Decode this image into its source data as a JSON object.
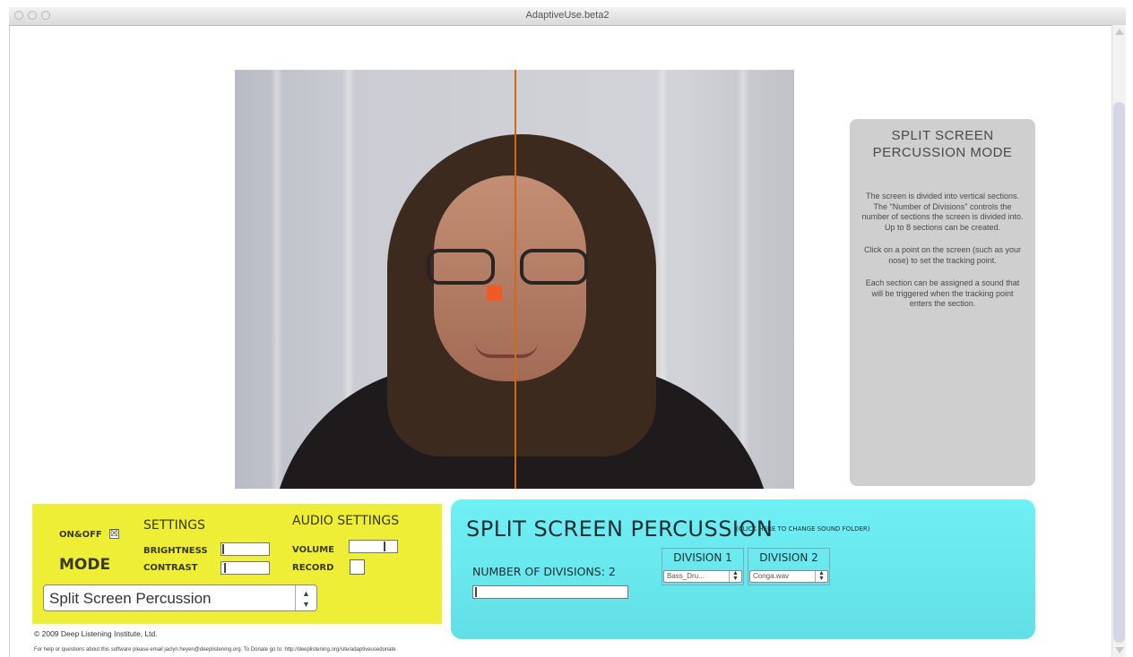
{
  "window": {
    "title": "AdaptiveUse.beta2"
  },
  "info_panel": {
    "title_line1": "SPLIT SCREEN",
    "title_line2": "PERCUSSION MODE",
    "paragraphs": [
      "The screen is divided into vertical sections. The \"Number of Divisions\" controls the number of sections the screen is divided into. Up to 8 sections can be created.",
      "Click on a point on the screen (such as your nose) to set the tracking point.",
      "Each section can be assigned a sound that will be triggered when the tracking point enters the section."
    ]
  },
  "controls": {
    "onoff_label": "ON&OFF",
    "onoff_checked": true,
    "onoff_mark": "☒",
    "settings_label": "SETTINGS",
    "brightness_label": "BRIGHTNESS",
    "contrast_label": "CONTRAST",
    "audio_settings_label": "AUDIO SETTINGS",
    "volume_label": "VOLUME",
    "record_label": "RECORD",
    "mode_label": "MODE",
    "mode_value": "Split Screen Percussion",
    "select_arrows": "▲\n▼"
  },
  "percussion": {
    "title": "SPLIT SCREEN PERCUSSION",
    "change_folder": "(CLICK HERE TO CHANGE SOUND FOLDER)",
    "divisions_label": "NUMBER OF DIVISIONS: 2",
    "division1_label": "DIVISION 1",
    "division1_value": "Bass_Dru...",
    "division2_label": "DIVISION 2",
    "division2_value": "Conga.wav",
    "arrows": "▲\n▼"
  },
  "footer": {
    "copyright": "© 2009 Deep Listening Institute, Ltd.",
    "help": "For help or questions about this software please email jaclyn.heyen@deeplistening.org. To Donate go to: http://deeplistening.org/site/adaptiveusedonate"
  }
}
